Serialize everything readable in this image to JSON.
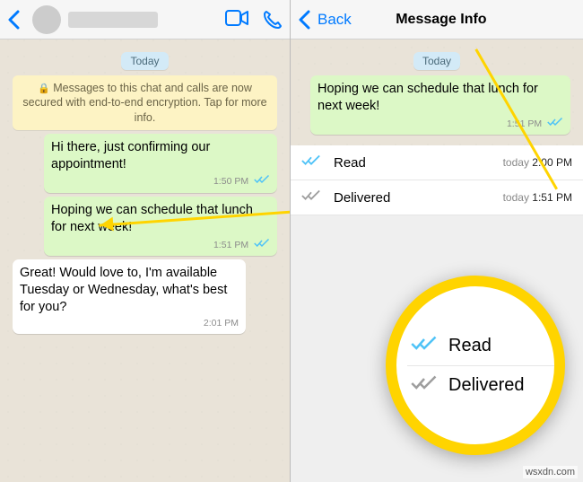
{
  "left": {
    "day_chip": "Today",
    "encryption": "Messages to this chat and calls are now secured with end-to-end encryption. Tap for more info.",
    "msg1": {
      "text": "Hi there, just confirming our appointment!",
      "time": "1:50 PM"
    },
    "msg2": {
      "text": "Hoping we can schedule that lunch for next week!",
      "time": "1:51 PM"
    },
    "msg3": {
      "text": "Great!  Would love to, I'm available Tuesday or Wednesday, what's best for you?",
      "time": "2:01 PM"
    }
  },
  "right": {
    "back": "Back",
    "title": "Message Info",
    "day_chip": "Today",
    "msg": {
      "text": "Hoping we can schedule that lunch for next week!",
      "time": "1:51 PM"
    },
    "rows": {
      "read": {
        "label": "Read",
        "prefix": "today",
        "time": "2:00 PM"
      },
      "delivered": {
        "label": "Delivered",
        "prefix": "today",
        "time": "1:51 PM"
      }
    }
  },
  "zoom": {
    "read": "Read",
    "delivered": "Delivered"
  },
  "watermark": "wsxdn.com"
}
